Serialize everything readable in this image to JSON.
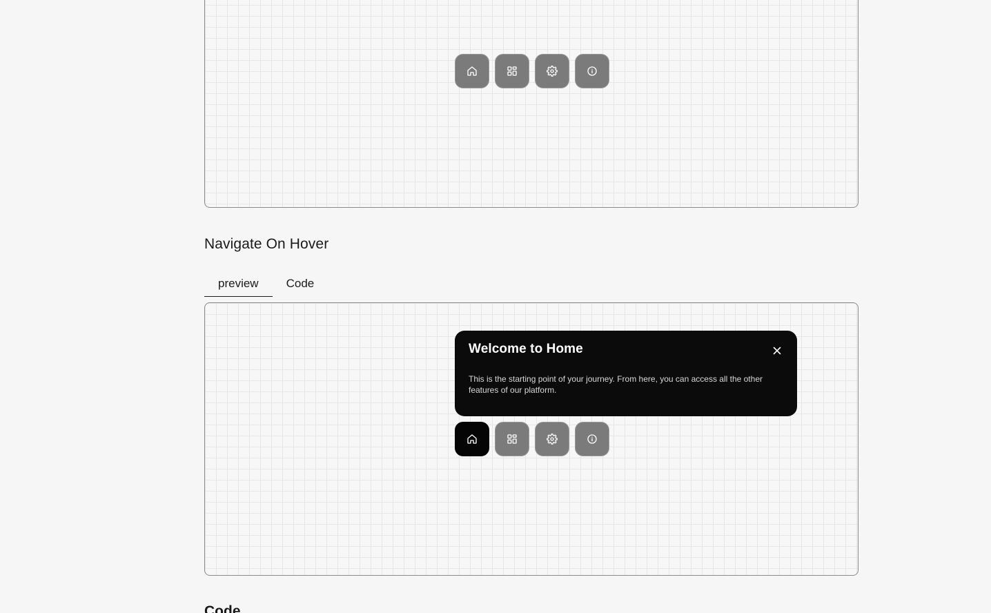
{
  "top_preview": {
    "dock": [
      {
        "icon": "home-icon",
        "active": false
      },
      {
        "icon": "grid-icon",
        "active": false
      },
      {
        "icon": "settings-icon",
        "active": false
      },
      {
        "icon": "info-icon",
        "active": false
      }
    ]
  },
  "section": {
    "title": "Navigate On Hover",
    "tabs": [
      {
        "label": "preview",
        "active": true
      },
      {
        "label": "Code",
        "active": false
      }
    ]
  },
  "popover": {
    "title": "Welcome to Home",
    "text": "This is the starting point of your journey. From here, you can access all the other features of our platform."
  },
  "bottom_preview": {
    "dock": [
      {
        "icon": "home-icon",
        "active": true
      },
      {
        "icon": "grid-icon",
        "active": false
      },
      {
        "icon": "settings-icon",
        "active": false
      },
      {
        "icon": "info-icon",
        "active": false
      }
    ]
  },
  "code_section": {
    "heading": "Code"
  },
  "colors": {
    "background": "#f5f6f5",
    "dock_button": "#7b7b7b",
    "dock_button_active": "#050505",
    "popover_bg": "#0b0b0b"
  }
}
